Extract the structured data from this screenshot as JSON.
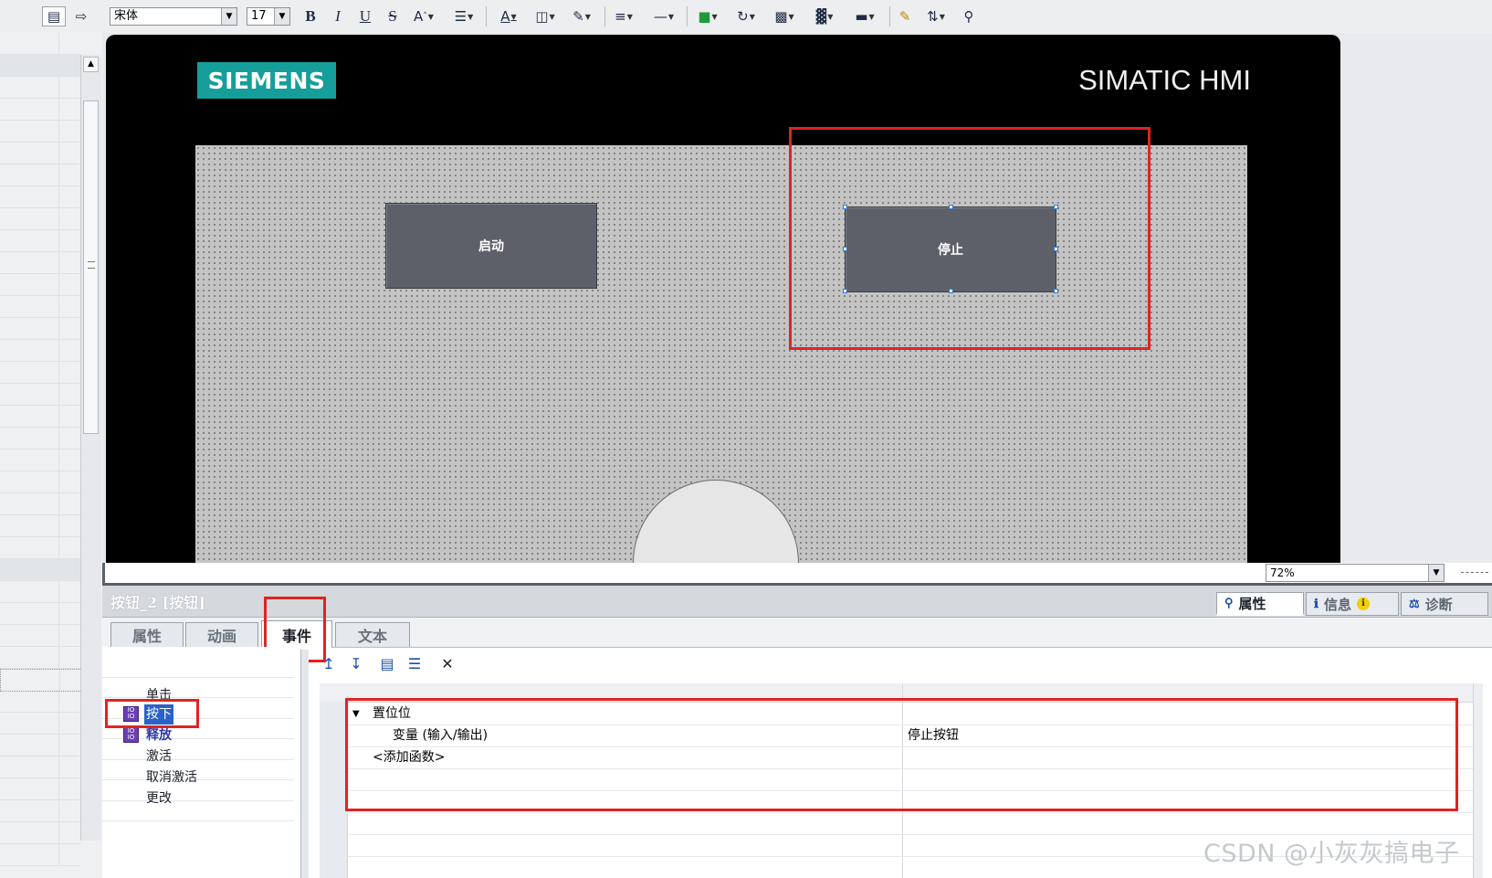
{
  "toolbar": {
    "font_family": "宋体",
    "font_size": "17",
    "bold": "B",
    "italic": "I",
    "underline": "U",
    "strike": "S",
    "icons": [
      "view-icon",
      "export-icon",
      "bold-icon",
      "italic-icon",
      "underline-icon",
      "strikethrough-icon",
      "text-size-icon",
      "align-icon",
      "font-color-icon",
      "fill-color-icon",
      "line-color-icon",
      "line-weight-icon",
      "line-style-icon",
      "bring-front-icon",
      "rotate-icon",
      "align-center-icon",
      "distribute-icon",
      "same-size-icon",
      "format-painter-icon",
      "tab-order-icon",
      "zoom-area-icon"
    ]
  },
  "hmi": {
    "logo": "SIEMENS",
    "title": "SIMATIC HMI",
    "buttons": [
      {
        "label": "启动"
      },
      {
        "label": "停止"
      }
    ]
  },
  "zoom": {
    "value": "72%"
  },
  "inspector": {
    "title": "按钮_2 [按钮]",
    "right_tabs": [
      {
        "label": "属性",
        "active": true
      },
      {
        "label": "信息",
        "active": false
      },
      {
        "label": "诊断",
        "active": false
      }
    ],
    "subtabs": [
      {
        "label": "属性",
        "active": false
      },
      {
        "label": "动画",
        "active": false
      },
      {
        "label": "事件",
        "active": true
      },
      {
        "label": "文本",
        "active": false
      }
    ],
    "events": [
      {
        "label": "单击"
      },
      {
        "label": "按下",
        "selected": true
      },
      {
        "label": "释放"
      },
      {
        "label": "激活"
      },
      {
        "label": "取消激活"
      },
      {
        "label": "更改"
      }
    ],
    "function_list": {
      "group": "置位位",
      "param_label": "变量 (输入/输出)",
      "param_value": "停止按钮",
      "add_function": "<添加函数>"
    }
  },
  "watermark": "CSDN @小灰灰搞电子",
  "colors": {
    "siemens_teal": "#159e9a",
    "highlight_red": "#e02323",
    "selection_blue": "#2a62c9",
    "button_gray": "#5d6069"
  }
}
